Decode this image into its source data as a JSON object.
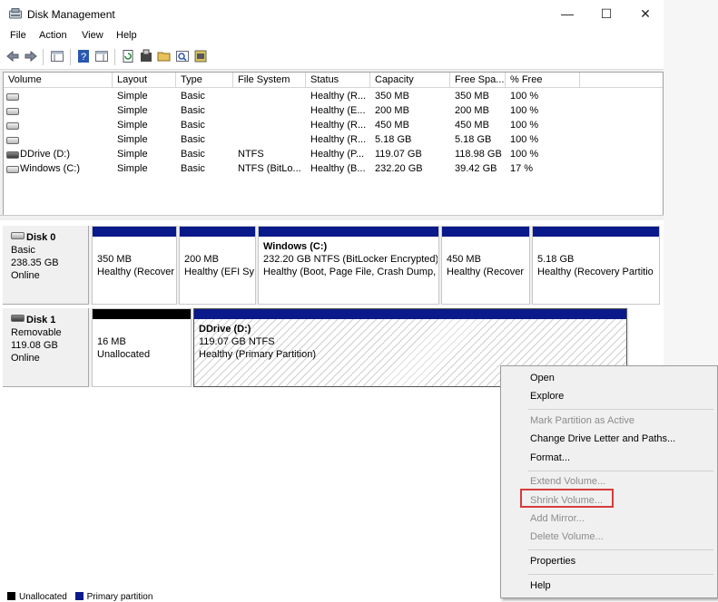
{
  "window": {
    "title": "Disk Management",
    "minimize": "—",
    "maximize": "☐",
    "close": "✕"
  },
  "menu": [
    "File",
    "Action",
    "View",
    "Help"
  ],
  "toolbar_icons": [
    "back-icon",
    "forward-icon",
    "console-tree-icon",
    "help-icon",
    "properties-pane-icon",
    "refresh-icon",
    "format-icon",
    "open-folder-icon",
    "search-icon",
    "wizard-icon"
  ],
  "volume_table": {
    "columns": [
      "Volume",
      "Layout",
      "Type",
      "File System",
      "Status",
      "Capacity",
      "Free Spa...",
      "% Free"
    ],
    "rows": [
      {
        "volume": "",
        "layout": "Simple",
        "type": "Basic",
        "fs": "",
        "status": "Healthy (R...",
        "capacity": "350 MB",
        "free": "350 MB",
        "pct": "100 %"
      },
      {
        "volume": "",
        "layout": "Simple",
        "type": "Basic",
        "fs": "",
        "status": "Healthy (E...",
        "capacity": "200 MB",
        "free": "200 MB",
        "pct": "100 %"
      },
      {
        "volume": "",
        "layout": "Simple",
        "type": "Basic",
        "fs": "",
        "status": "Healthy (R...",
        "capacity": "450 MB",
        "free": "450 MB",
        "pct": "100 %"
      },
      {
        "volume": "",
        "layout": "Simple",
        "type": "Basic",
        "fs": "",
        "status": "Healthy (R...",
        "capacity": "5.18 GB",
        "free": "5.18 GB",
        "pct": "100 %"
      },
      {
        "volume": "DDrive (D:)",
        "layout": "Simple",
        "type": "Basic",
        "fs": "NTFS",
        "status": "Healthy (P...",
        "capacity": "119.07 GB",
        "free": "118.98 GB",
        "pct": "100 %"
      },
      {
        "volume": "Windows (C:)",
        "layout": "Simple",
        "type": "Basic",
        "fs": "NTFS (BitLo...",
        "status": "Healthy (B...",
        "capacity": "232.20 GB",
        "free": "39.42 GB",
        "pct": "17 %"
      }
    ]
  },
  "disks": [
    {
      "name": "Disk 0",
      "kind": "Basic",
      "size": "238.35 GB",
      "state": "Online",
      "partitions": [
        {
          "name": "",
          "line1": "350 MB",
          "line2": "Healthy (Recover"
        },
        {
          "name": "",
          "line1": "200 MB",
          "line2": "Healthy (EFI Sy"
        },
        {
          "name": "Windows  (C:)",
          "line1": "232.20 GB NTFS (BitLocker Encrypted)",
          "line2": "Healthy (Boot, Page File, Crash Dump,"
        },
        {
          "name": "",
          "line1": "450 MB",
          "line2": "Healthy (Recover"
        },
        {
          "name": "",
          "line1": "5.18 GB",
          "line2": "Healthy (Recovery Partitio"
        }
      ]
    },
    {
      "name": "Disk 1",
      "kind": "Removable",
      "size": "119.08 GB",
      "state": "Online",
      "partitions": [
        {
          "name": "",
          "line1": "16 MB",
          "line2": "Unallocated"
        },
        {
          "name": "DDrive  (D:)",
          "line1": "119.07 GB NTFS",
          "line2": "Healthy (Primary Partition)"
        }
      ]
    }
  ],
  "legend": {
    "unallocated": "Unallocated",
    "primary": "Primary partition",
    "colors": {
      "unallocated": "#000000",
      "primary": "#0a1a8a"
    }
  },
  "context_menu": {
    "open": "Open",
    "explore": "Explore",
    "mark_active": "Mark Partition as Active",
    "change_letter": "Change Drive Letter and Paths...",
    "format": "Format...",
    "extend": "Extend Volume...",
    "shrink": "Shrink Volume...",
    "add_mirror": "Add Mirror...",
    "delete": "Delete Volume...",
    "properties": "Properties",
    "help": "Help"
  },
  "colors": {
    "partition_bar": "#0a1a8a",
    "highlight": "#d63b3b"
  }
}
